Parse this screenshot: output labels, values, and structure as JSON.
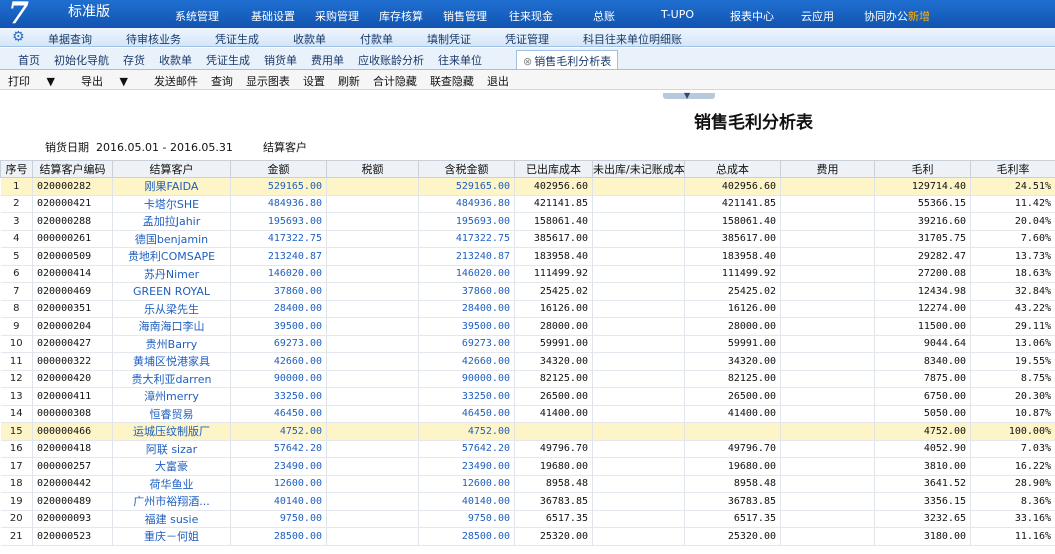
{
  "app": {
    "logo_mark": "7",
    "edition": "标准版"
  },
  "top_nav": [
    "系统管理",
    "基础设置",
    "采购管理",
    "库存核算",
    "销售管理",
    "往来现金",
    "总账",
    "T-UPO",
    "报表中心",
    "云应用",
    "协同办公"
  ],
  "top_nav_badge": "新增",
  "shortcuts": [
    "单据查询",
    "待审核业务",
    "凭证生成",
    "收款单",
    "付款单",
    "填制凭证",
    "凭证管理",
    "科目往来单位明细账"
  ],
  "tabs": [
    "首页",
    "初始化导航",
    "存货",
    "收款单",
    "凭证生成",
    "销货单",
    "费用单",
    "应收账龄分析",
    "往来单位"
  ],
  "active_tab": "销售毛利分析表",
  "toolbar": {
    "print": "打印",
    "export": "导出",
    "buttons": [
      "发送邮件",
      "查询",
      "显示图表",
      "设置",
      "刷新",
      "合计隐藏",
      "联查隐藏",
      "退出"
    ]
  },
  "report_title": "销售毛利分析表",
  "filter": {
    "date_label": "销货日期",
    "date_value": "2016.05.01 - 2016.05.31",
    "customer_label": "结算客户"
  },
  "columns": [
    "序号",
    "结算客户编码",
    "结算客户",
    "金额",
    "税额",
    "含税金额",
    "已出库成本",
    "未出库/未记账成本",
    "总成本",
    "费用",
    "毛利",
    "毛利率"
  ],
  "rows": [
    {
      "idx": "1",
      "code": "020000282",
      "name": "刚果FAIDA",
      "amount": "529165.00",
      "tax": "",
      "total": "529165.00",
      "out_cost": "402956.60",
      "unrec_cost": "",
      "total_cost": "402956.60",
      "fee": "",
      "profit": "129714.40",
      "rate": "24.51%",
      "hl": true
    },
    {
      "idx": "2",
      "code": "020000421",
      "name": "卡塔尔SHE",
      "amount": "484936.80",
      "tax": "",
      "total": "484936.80",
      "out_cost": "421141.85",
      "unrec_cost": "",
      "total_cost": "421141.85",
      "fee": "",
      "profit": "55366.15",
      "rate": "11.42%"
    },
    {
      "idx": "3",
      "code": "020000288",
      "name": "孟加拉Jahir",
      "amount": "195693.00",
      "tax": "",
      "total": "195693.00",
      "out_cost": "158061.40",
      "unrec_cost": "",
      "total_cost": "158061.40",
      "fee": "",
      "profit": "39216.60",
      "rate": "20.04%"
    },
    {
      "idx": "4",
      "code": "000000261",
      "name": "德国benjamin",
      "amount": "417322.75",
      "tax": "",
      "total": "417322.75",
      "out_cost": "385617.00",
      "unrec_cost": "",
      "total_cost": "385617.00",
      "fee": "",
      "profit": "31705.75",
      "rate": "7.60%"
    },
    {
      "idx": "5",
      "code": "020000509",
      "name": "贵地利COMSAPE",
      "amount": "213240.87",
      "tax": "",
      "total": "213240.87",
      "out_cost": "183958.40",
      "unrec_cost": "",
      "total_cost": "183958.40",
      "fee": "",
      "profit": "29282.47",
      "rate": "13.73%"
    },
    {
      "idx": "6",
      "code": "020000414",
      "name": "苏丹Nimer",
      "amount": "146020.00",
      "tax": "",
      "total": "146020.00",
      "out_cost": "111499.92",
      "unrec_cost": "",
      "total_cost": "111499.92",
      "fee": "",
      "profit": "27200.08",
      "rate": "18.63%"
    },
    {
      "idx": "7",
      "code": "020000469",
      "name": "GREEN ROYAL",
      "amount": "37860.00",
      "tax": "",
      "total": "37860.00",
      "out_cost": "25425.02",
      "unrec_cost": "",
      "total_cost": "25425.02",
      "fee": "",
      "profit": "12434.98",
      "rate": "32.84%"
    },
    {
      "idx": "8",
      "code": "020000351",
      "name": "乐从梁先生",
      "amount": "28400.00",
      "tax": "",
      "total": "28400.00",
      "out_cost": "16126.00",
      "unrec_cost": "",
      "total_cost": "16126.00",
      "fee": "",
      "profit": "12274.00",
      "rate": "43.22%"
    },
    {
      "idx": "9",
      "code": "020000204",
      "name": "海南海口李山",
      "amount": "39500.00",
      "tax": "",
      "total": "39500.00",
      "out_cost": "28000.00",
      "unrec_cost": "",
      "total_cost": "28000.00",
      "fee": "",
      "profit": "11500.00",
      "rate": "29.11%"
    },
    {
      "idx": "10",
      "code": "020000427",
      "name": "贵州Barry",
      "amount": "69273.00",
      "tax": "",
      "total": "69273.00",
      "out_cost": "59991.00",
      "unrec_cost": "",
      "total_cost": "59991.00",
      "fee": "",
      "profit": "9044.64",
      "rate": "13.06%"
    },
    {
      "idx": "11",
      "code": "000000322",
      "name": "黄埔区悦港家具",
      "amount": "42660.00",
      "tax": "",
      "total": "42660.00",
      "out_cost": "34320.00",
      "unrec_cost": "",
      "total_cost": "34320.00",
      "fee": "",
      "profit": "8340.00",
      "rate": "19.55%"
    },
    {
      "idx": "12",
      "code": "020000420",
      "name": "贵大利亚darren",
      "amount": "90000.00",
      "tax": "",
      "total": "90000.00",
      "out_cost": "82125.00",
      "unrec_cost": "",
      "total_cost": "82125.00",
      "fee": "",
      "profit": "7875.00",
      "rate": "8.75%"
    },
    {
      "idx": "13",
      "code": "020000411",
      "name": "漳州merry",
      "amount": "33250.00",
      "tax": "",
      "total": "33250.00",
      "out_cost": "26500.00",
      "unrec_cost": "",
      "total_cost": "26500.00",
      "fee": "",
      "profit": "6750.00",
      "rate": "20.30%"
    },
    {
      "idx": "14",
      "code": "000000308",
      "name": "恒睿贸易",
      "amount": "46450.00",
      "tax": "",
      "total": "46450.00",
      "out_cost": "41400.00",
      "unrec_cost": "",
      "total_cost": "41400.00",
      "fee": "",
      "profit": "5050.00",
      "rate": "10.87%"
    },
    {
      "idx": "15",
      "code": "000000466",
      "name": "运城压纹制版厂",
      "amount": "4752.00",
      "tax": "",
      "total": "4752.00",
      "out_cost": "",
      "unrec_cost": "",
      "total_cost": "",
      "fee": "",
      "profit": "4752.00",
      "rate": "100.00%",
      "hl": true
    },
    {
      "idx": "16",
      "code": "020000418",
      "name": "阿联 sizar",
      "amount": "57642.20",
      "tax": "",
      "total": "57642.20",
      "out_cost": "49796.70",
      "unrec_cost": "",
      "total_cost": "49796.70",
      "fee": "",
      "profit": "4052.90",
      "rate": "7.03%"
    },
    {
      "idx": "17",
      "code": "000000257",
      "name": "大富豪",
      "amount": "23490.00",
      "tax": "",
      "total": "23490.00",
      "out_cost": "19680.00",
      "unrec_cost": "",
      "total_cost": "19680.00",
      "fee": "",
      "profit": "3810.00",
      "rate": "16.22%"
    },
    {
      "idx": "18",
      "code": "020000442",
      "name": "荷华鱼业",
      "amount": "12600.00",
      "tax": "",
      "total": "12600.00",
      "out_cost": "8958.48",
      "unrec_cost": "",
      "total_cost": "8958.48",
      "fee": "",
      "profit": "3641.52",
      "rate": "28.90%"
    },
    {
      "idx": "19",
      "code": "020000489",
      "name": "广州市裕翔酒...",
      "amount": "40140.00",
      "tax": "",
      "total": "40140.00",
      "out_cost": "36783.85",
      "unrec_cost": "",
      "total_cost": "36783.85",
      "fee": "",
      "profit": "3356.15",
      "rate": "8.36%"
    },
    {
      "idx": "20",
      "code": "020000093",
      "name": "福建 susie",
      "amount": "9750.00",
      "tax": "",
      "total": "9750.00",
      "out_cost": "6517.35",
      "unrec_cost": "",
      "total_cost": "6517.35",
      "fee": "",
      "profit": "3232.65",
      "rate": "33.16%"
    },
    {
      "idx": "21",
      "code": "020000523",
      "name": "重庆－何姐",
      "amount": "28500.00",
      "tax": "",
      "total": "28500.00",
      "out_cost": "25320.00",
      "unrec_cost": "",
      "total_cost": "25320.00",
      "fee": "",
      "profit": "3180.00",
      "rate": "11.16%"
    }
  ]
}
